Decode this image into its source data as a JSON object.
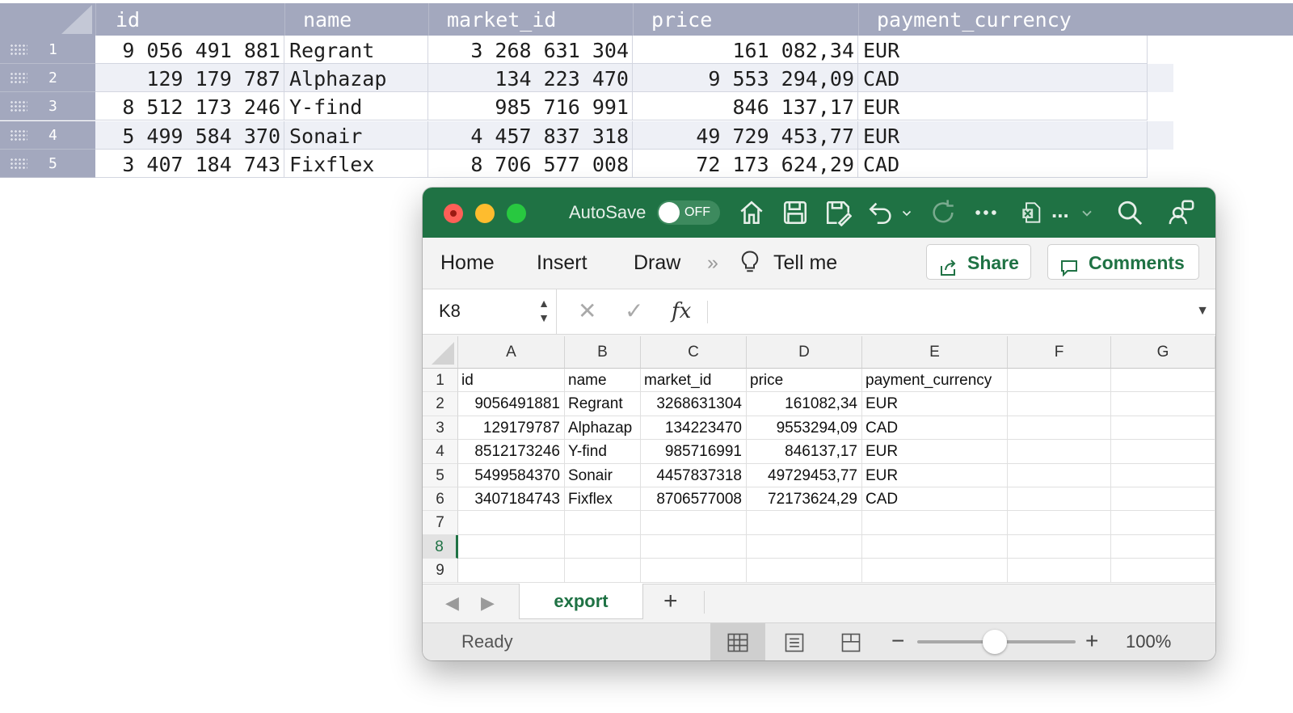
{
  "grid": {
    "columns": [
      "id",
      "name",
      "market_id",
      "price",
      "payment_currency"
    ],
    "rows": [
      {
        "num": "1",
        "id": "9 056 491 881",
        "name": "Regrant",
        "market_id": "3 268 631 304",
        "price": "161 082,34",
        "payment_currency": "EUR"
      },
      {
        "num": "2",
        "id": "129 179 787",
        "name": "Alphazap",
        "market_id": "134 223 470",
        "price": "9 553 294,09",
        "payment_currency": "CAD"
      },
      {
        "num": "3",
        "id": "8 512 173 246",
        "name": "Y-find",
        "market_id": "985 716 991",
        "price": "846 137,17",
        "payment_currency": "EUR"
      },
      {
        "num": "4",
        "id": "5 499 584 370",
        "name": "Sonair",
        "market_id": "4 457 837 318",
        "price": "49 729 453,77",
        "payment_currency": "EUR"
      },
      {
        "num": "5",
        "id": "3 407 184 743",
        "name": "Fixflex",
        "market_id": "8 706 577 008",
        "price": "72 173 624,29",
        "payment_currency": "CAD"
      }
    ]
  },
  "excel": {
    "titlebar": {
      "autosave_label": "AutoSave",
      "autosave_state": "OFF",
      "icons": [
        "home-icon",
        "save-icon",
        "save-as-icon",
        "undo-icon",
        "undo-dropdown-icon",
        "redo-icon",
        "more-icon",
        "excel-file-icon",
        "search-icon",
        "person-icon"
      ],
      "filename_truncated": "...",
      "accent": "#1f7244"
    },
    "ribbon": {
      "tabs": [
        "Home",
        "Insert",
        "Draw"
      ],
      "overflow": "»",
      "tell_me": "Tell me",
      "share": "Share",
      "comments": "Comments"
    },
    "formula_bar": {
      "name_box": "K8",
      "fx": "fx",
      "value": ""
    },
    "sheet": {
      "columns": [
        "A",
        "B",
        "C",
        "D",
        "E",
        "F",
        "G"
      ],
      "row_numbers": [
        "1",
        "2",
        "3",
        "4",
        "5",
        "6",
        "7",
        "8",
        "9"
      ],
      "selected_row": "8",
      "header_row": [
        "id",
        "name",
        "market_id",
        "price",
        "payment_currency"
      ],
      "data": [
        [
          "9056491881",
          "Regrant",
          "3268631304",
          "161082,34",
          "EUR"
        ],
        [
          "129179787",
          "Alphazap",
          "134223470",
          "9553294,09",
          "CAD"
        ],
        [
          "8512173246",
          "Y-find",
          "985716991",
          "846137,17",
          "EUR"
        ],
        [
          "5499584370",
          "Sonair",
          "4457837318",
          "49729453,77",
          "EUR"
        ],
        [
          "3407184743",
          "Fixflex",
          "8706577008",
          "72173624,29",
          "CAD"
        ]
      ]
    },
    "tabs": {
      "active": "export",
      "add": "+"
    },
    "status": {
      "text": "Ready",
      "zoom_minus": "−",
      "zoom_plus": "+",
      "zoom": "100%",
      "zoom_fraction": 0.5
    }
  }
}
